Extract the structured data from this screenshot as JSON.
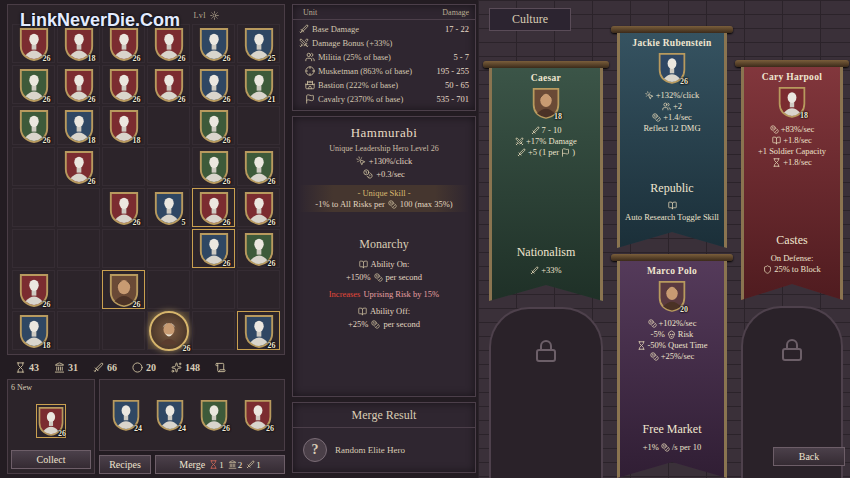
{
  "watermark": "LinkNeverDie.Com",
  "grid": {
    "header": "Lvl",
    "cells": [
      {
        "kind": "bust",
        "color": "#7b2c30",
        "level": "26",
        "framed": false,
        "selected": false
      },
      {
        "kind": "bust",
        "color": "#7b2c30",
        "level": "18",
        "framed": false,
        "selected": false
      },
      {
        "kind": "bust",
        "color": "#7b2c30",
        "level": "26",
        "framed": false,
        "selected": false
      },
      {
        "kind": "bust",
        "color": "#7b2c30",
        "level": "26",
        "framed": false,
        "selected": false
      },
      {
        "kind": "bust",
        "color": "#2f4763",
        "level": "26",
        "framed": false,
        "selected": false
      },
      {
        "kind": "bust",
        "color": "#2f4763",
        "level": "25",
        "framed": false,
        "selected": false
      },
      {
        "kind": "bust",
        "color": "#3d5a3a",
        "level": "26",
        "framed": false,
        "selected": false
      },
      {
        "kind": "bust",
        "color": "#7b2c30",
        "level": "26",
        "framed": false,
        "selected": false
      },
      {
        "kind": "bust",
        "color": "#7b2c30",
        "level": "26",
        "framed": false,
        "selected": false
      },
      {
        "kind": "bust",
        "color": "#7b2c30",
        "level": "26",
        "framed": false,
        "selected": false
      },
      {
        "kind": "bust",
        "color": "#2f4763",
        "level": "26",
        "framed": false,
        "selected": false
      },
      {
        "kind": "bust",
        "color": "#3d5a3a",
        "level": "21",
        "framed": false,
        "selected": false
      },
      {
        "kind": "bust",
        "color": "#3d5a3a",
        "level": "26",
        "framed": false,
        "selected": false
      },
      {
        "kind": "bust",
        "color": "#2f4763",
        "level": "18",
        "framed": false,
        "selected": false
      },
      {
        "kind": "bust",
        "color": "#7b2c30",
        "level": "18",
        "framed": false,
        "selected": false
      },
      {
        "kind": "empty",
        "framed": false,
        "selected": false
      },
      {
        "kind": "bust",
        "color": "#3d5a3a",
        "level": "26",
        "framed": false,
        "selected": false
      },
      {
        "kind": "empty",
        "framed": false,
        "selected": false
      },
      {
        "kind": "empty",
        "framed": false,
        "selected": false
      },
      {
        "kind": "bust",
        "color": "#7b2c30",
        "level": "26",
        "framed": false,
        "selected": false
      },
      {
        "kind": "empty",
        "framed": false,
        "selected": false
      },
      {
        "kind": "empty",
        "framed": false,
        "selected": false
      },
      {
        "kind": "bust",
        "color": "#3d5a3a",
        "level": "26",
        "framed": false,
        "selected": false
      },
      {
        "kind": "bust",
        "color": "#3d5a3a",
        "level": "26",
        "framed": false,
        "selected": false
      },
      {
        "kind": "empty",
        "framed": false,
        "selected": false
      },
      {
        "kind": "empty",
        "framed": false,
        "selected": false
      },
      {
        "kind": "bust",
        "color": "#7b2c30",
        "level": "26",
        "framed": false,
        "selected": false
      },
      {
        "kind": "bust",
        "color": "#2f4763",
        "level": "5",
        "framed": false,
        "selected": false
      },
      {
        "kind": "bust",
        "color": "#7b2c30",
        "level": "26",
        "framed": true,
        "selected": false
      },
      {
        "kind": "bust",
        "color": "#7b2c30",
        "level": "26",
        "framed": false,
        "selected": false
      },
      {
        "kind": "empty",
        "framed": false,
        "selected": false
      },
      {
        "kind": "empty",
        "framed": false,
        "selected": false
      },
      {
        "kind": "empty",
        "framed": false,
        "selected": false
      },
      {
        "kind": "empty",
        "framed": false,
        "selected": false
      },
      {
        "kind": "bust",
        "color": "#2f4763",
        "level": "26",
        "framed": true,
        "selected": false
      },
      {
        "kind": "bust",
        "color": "#3d5a3a",
        "level": "26",
        "framed": false,
        "selected": false
      },
      {
        "kind": "bust",
        "color": "#7b2c30",
        "level": "26",
        "framed": false,
        "selected": false
      },
      {
        "kind": "empty",
        "framed": false,
        "selected": false
      },
      {
        "kind": "portrait",
        "color": "#6a4a36",
        "level": "26",
        "framed": true,
        "selected": false
      },
      {
        "kind": "empty",
        "framed": false,
        "selected": false
      },
      {
        "kind": "empty",
        "framed": false,
        "selected": false
      },
      {
        "kind": "empty",
        "framed": false,
        "selected": false
      },
      {
        "kind": "bust",
        "color": "#2f4763",
        "level": "18",
        "framed": false,
        "selected": false
      },
      {
        "kind": "empty",
        "framed": false,
        "selected": false
      },
      {
        "kind": "empty",
        "framed": false,
        "selected": false
      },
      {
        "kind": "medallion",
        "color": "#6a4a36",
        "level": "26",
        "framed": false,
        "selected": true
      },
      {
        "kind": "empty",
        "framed": false,
        "selected": false
      },
      {
        "kind": "bust",
        "color": "#2f4763",
        "level": "26",
        "framed": true,
        "selected": false
      }
    ]
  },
  "resources": [
    {
      "kind": "hourglass",
      "value": "43"
    },
    {
      "kind": "pillar",
      "value": "31"
    },
    {
      "kind": "sword",
      "value": "66"
    },
    {
      "kind": "orb",
      "value": "20"
    },
    {
      "kind": "star",
      "value": "148"
    }
  ],
  "collect": {
    "label": "6 New",
    "hero": {
      "kind": "bust",
      "color": "#7b2c30",
      "level": "26",
      "framed": true
    },
    "button": "Collect"
  },
  "merge_slots": [
    {
      "kind": "bust",
      "color": "#2f4763",
      "level": "24"
    },
    {
      "kind": "bust",
      "color": "#2f4763",
      "level": "24"
    },
    {
      "kind": "bust",
      "color": "#3d5a3a",
      "level": "26"
    },
    {
      "kind": "bust",
      "color": "#7b2c30",
      "level": "26"
    }
  ],
  "recipes_button": "Recipes",
  "merge_button": {
    "label": "Merge",
    "costs": [
      {
        "kind": "hourglass",
        "value": "1"
      },
      {
        "kind": "pillar",
        "value": "2"
      },
      {
        "kind": "sword",
        "value": "1"
      }
    ]
  },
  "unit_table": {
    "columns": [
      "Unit",
      "Damage"
    ],
    "rows": [
      {
        "kind": "base",
        "label": "Base Damage",
        "value": "17 - 22"
      },
      {
        "kind": "section",
        "label": "Damage Bonus (+33%)"
      },
      {
        "kind": "militia",
        "label": "Militia (25% of base)",
        "value": "5 - 7"
      },
      {
        "kind": "musketman",
        "label": "Musketman (863% of base)",
        "value": "195 - 255"
      },
      {
        "kind": "bastion",
        "label": "Bastion (222% of base)",
        "value": "50 - 65"
      },
      {
        "kind": "cavalry",
        "label": "Cavalry (2370% of base)",
        "value": "535 - 701"
      }
    ]
  },
  "hero": {
    "name": "Hammurabi",
    "subtitle": "Unique Leadership Hero Level 26",
    "bonuses": [
      {
        "kind": "click",
        "text": "+130%/click"
      },
      {
        "kind": "gold",
        "text": "+0.3/sec"
      }
    ],
    "skill_title": "- Unique Skill -",
    "skill": {
      "text": "-1% to All Risks per",
      "after": "100 (max 35%)"
    },
    "culture": "Monarchy",
    "on_label": "Ability On:",
    "on_effect": {
      "text": "+150%",
      "after": "per second"
    },
    "warning": {
      "prefix": "Increases",
      "text": "Uprising Risk by 15%"
    },
    "off_label": "Ability Off:",
    "off_effect": {
      "text": "+25%",
      "after": "per second"
    }
  },
  "merge_result": {
    "title": "Merge Result",
    "icon": "?",
    "text": "Random Elite Hero"
  },
  "culture": {
    "title": "Culture",
    "columns": [
      [
        {
          "kind": "banner",
          "name": "Caesar",
          "color": "#2f4a3c",
          "hero": {
            "kind": "portrait",
            "color": "#6a4a36",
            "level": "18"
          },
          "stats": [
            {
              "kind": "attack",
              "text": "7 - 10"
            },
            {
              "kind": "damage",
              "text": "+17% Damage"
            },
            {
              "kind": "attack",
              "text": "+5 (1 per",
              "mid": "cavalry",
              "after": ")"
            }
          ],
          "culture": "Nationalism",
          "effects": [
            {
              "kind": "attack",
              "text": "+33%"
            }
          ]
        },
        {
          "kind": "locked"
        }
      ],
      [
        {
          "kind": "banner",
          "name": "Jackie Rubenstein",
          "color": "#294857",
          "hero": {
            "kind": "bust",
            "color": "#2f4763",
            "level": "26"
          },
          "stats": [
            {
              "kind": "click",
              "text": "+132%/click"
            },
            {
              "kind": "soldier",
              "text": "+2"
            },
            {
              "kind": "gold",
              "text": "+1.4/sec"
            },
            {
              "kind": "plain",
              "text": "Reflect 12 DMG"
            }
          ],
          "culture": "Republic",
          "effects": [
            {
              "kind": "research",
              "text": "Auto Research Toggle Skill"
            }
          ]
        },
        {
          "kind": "banner",
          "name": "Marco Polo",
          "color": "#4a2e50",
          "hero": {
            "kind": "portrait",
            "color": "#5a3a40",
            "level": "20"
          },
          "stats": [
            {
              "kind": "gold",
              "text": "+102%/sec"
            },
            {
              "kind": "plain",
              "text": "-5%",
              "mid": "risk",
              "after": "Risk"
            },
            {
              "kind": "time",
              "text": "-50% Quest Time"
            },
            {
              "kind": "gold",
              "text": "+25%/sec"
            }
          ],
          "culture": "Free Market",
          "effects": [
            {
              "kind": "plain",
              "text": "+1%",
              "mid": "gold",
              "after": "/s per 10"
            }
          ]
        }
      ],
      [
        {
          "kind": "banner",
          "name": "Cary Harpool",
          "color": "#7a2a30",
          "hero": {
            "kind": "bust",
            "color": "#7b2c30",
            "level": "18"
          },
          "stats": [
            {
              "kind": "gold",
              "text": "+83%/sec"
            },
            {
              "kind": "research",
              "text": "+1.8/sec"
            },
            {
              "kind": "plain",
              "text": "+1 Soldier Capacity"
            },
            {
              "kind": "time",
              "text": "+1.8/sec"
            }
          ],
          "culture": "Castes",
          "effects": [
            {
              "kind": "plain",
              "text": "On Defense:"
            },
            {
              "kind": "defense",
              "text": "25% to Block"
            }
          ]
        },
        {
          "kind": "locked",
          "button": "Back"
        }
      ]
    ]
  }
}
